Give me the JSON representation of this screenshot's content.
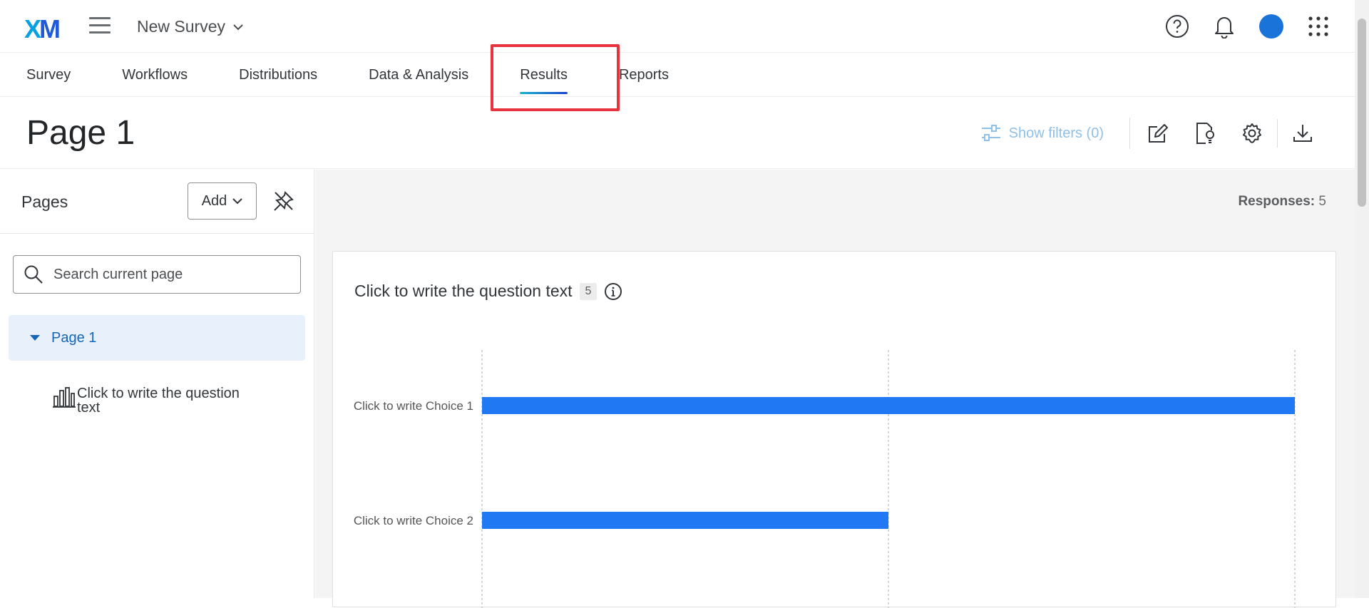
{
  "app": {
    "logo": "XM",
    "survey_name": "New Survey"
  },
  "nav": {
    "tabs": [
      {
        "label": "Survey"
      },
      {
        "label": "Workflows"
      },
      {
        "label": "Distributions"
      },
      {
        "label": "Data & Analysis"
      },
      {
        "label": "Results"
      },
      {
        "label": "Reports"
      }
    ],
    "active_tab": "Results"
  },
  "header": {
    "title": "Page 1",
    "show_filters_label": "Show filters (0)"
  },
  "sidebar": {
    "title": "Pages",
    "add_label": "Add",
    "search_placeholder": "Search current page",
    "page_item": "Page 1",
    "question_item": "Click to write the question text"
  },
  "main": {
    "responses_label": "Responses:",
    "responses_count": "5",
    "question_text": "Click to write the question text",
    "question_count": "5"
  },
  "colors": {
    "accent": "#1a73d9",
    "bar": "#2079f2",
    "highlight": "#e8323c"
  },
  "chart_data": {
    "type": "bar",
    "orientation": "horizontal",
    "categories": [
      "Click to write Choice 1",
      "Click to write Choice 2"
    ],
    "values": [
      1.0,
      0.5
    ],
    "grid": true
  }
}
